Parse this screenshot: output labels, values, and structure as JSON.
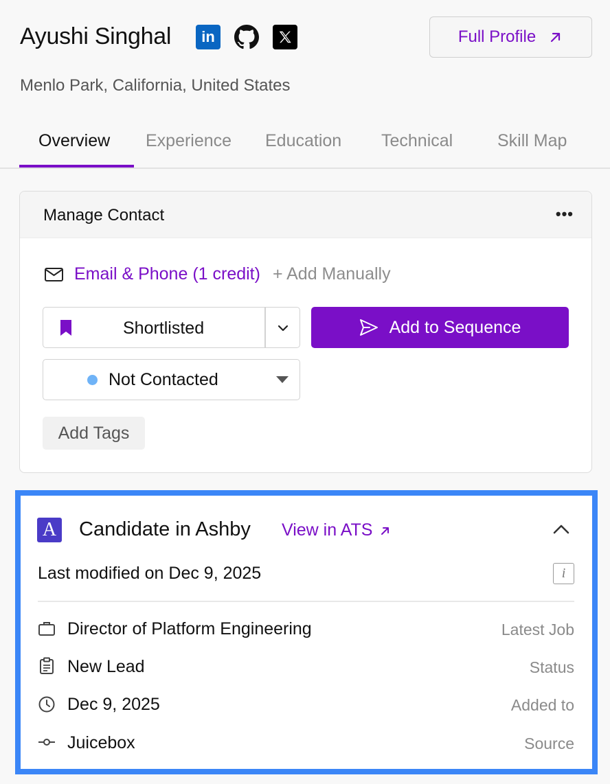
{
  "profile": {
    "name": "Ayushi Singhal",
    "location": "Menlo Park, California, United States",
    "full_profile_label": "Full Profile",
    "social": [
      "linkedin-icon",
      "github-icon",
      "x-icon"
    ]
  },
  "tabs": [
    {
      "label": "Overview",
      "active": true
    },
    {
      "label": "Experience",
      "active": false
    },
    {
      "label": "Education",
      "active": false
    },
    {
      "label": "Technical",
      "active": false
    },
    {
      "label": "Skill Map",
      "active": false
    }
  ],
  "manage_contact": {
    "title": "Manage Contact",
    "email_phone_label": "Email & Phone (1 credit)",
    "add_manually_label": "+ Add Manually",
    "shortlist_status": "Shortlisted",
    "add_to_sequence_label": "Add to Sequence",
    "contact_status": "Not Contacted",
    "add_tags_label": "Add Tags"
  },
  "ashby": {
    "title": "Candidate in Ashby",
    "view_ats_label": "View in ATS",
    "last_modified": "Last modified on Dec 9, 2025",
    "rows": [
      {
        "icon": "briefcase-icon",
        "value": "Director of Platform Engineering",
        "key": "Latest Job"
      },
      {
        "icon": "clipboard-icon",
        "value": "New Lead",
        "key": "Status"
      },
      {
        "icon": "clock-icon",
        "value": "Dec 9, 2025",
        "key": "Added to"
      },
      {
        "icon": "commit-icon",
        "value": "Juicebox",
        "key": "Source"
      }
    ]
  },
  "colors": {
    "accent": "#7a0fc7",
    "highlight_border": "#3b86f7",
    "status_dot": "#6fb3f7",
    "ashby_logo": "#4a3bc7"
  }
}
